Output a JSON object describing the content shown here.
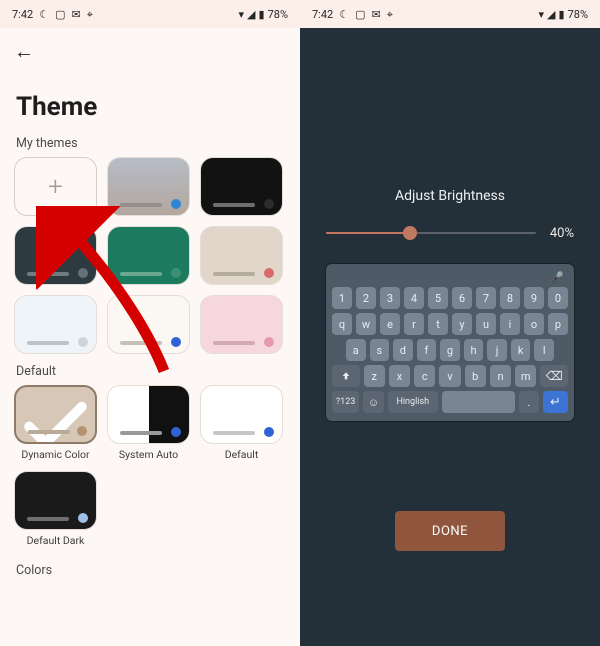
{
  "status": {
    "time": "7:42",
    "battery": "78%",
    "iconsLeft": [
      "moon",
      "card",
      "mail",
      "pin"
    ],
    "iconsRight": [
      "wifi",
      "signal",
      "battery"
    ]
  },
  "left": {
    "title": "Theme",
    "sections": {
      "myThemes": "My themes",
      "default": "Default",
      "colors": "Colors"
    },
    "myThemes": [
      {
        "type": "add"
      },
      {
        "type": "gradient",
        "dot": "#2f86d8"
      },
      {
        "type": "solid",
        "bg": "#121212",
        "bar": "#6e6e6e",
        "dot": "#2c2c2c"
      },
      {
        "type": "solid",
        "bg": "#2d3b40",
        "bar": "#6f7b80",
        "dot": "#647179"
      },
      {
        "type": "solid",
        "bg": "#1c7b5e",
        "bar": "#6aa892",
        "dot": "#3d8f74"
      },
      {
        "type": "solid",
        "bg": "#e1d6c9",
        "bar": "#b4ab9f",
        "dot": "#d86a6a"
      },
      {
        "type": "solid",
        "bg": "#eef4f7",
        "bar": "#bac4ca",
        "dot": "#cdd5da"
      },
      {
        "type": "solid",
        "bg": "#fbf7f3",
        "bar": "#c7c0b8",
        "dot": "#2f62d4"
      },
      {
        "type": "solid",
        "bg": "#f6d6df",
        "bar": "#d4a9b6",
        "dot": "#e59ab2"
      }
    ],
    "defaults": [
      {
        "label": "Dynamic Color",
        "bg": "#d7c7b7",
        "bar": "#b9aa99",
        "dot": "#b7926e",
        "selected": true
      },
      {
        "label": "System Auto",
        "split": true,
        "dot": "#2f62d4"
      },
      {
        "label": "Default",
        "bg": "#ffffff",
        "bar": "#c7c7c7",
        "dot": "#2f62d4"
      },
      {
        "label": "Default Dark",
        "bg": "#1a1a1a",
        "bar": "#6e6e6e",
        "dot": "#9fbfe6"
      }
    ]
  },
  "right": {
    "title": "Adjust Brightness",
    "value": "40%",
    "percent": 40,
    "keyboard": {
      "row1": [
        "1",
        "2",
        "3",
        "4",
        "5",
        "6",
        "7",
        "8",
        "9",
        "0"
      ],
      "row2": [
        "q",
        "w",
        "e",
        "r",
        "t",
        "y",
        "u",
        "i",
        "o",
        "p"
      ],
      "row3": [
        "a",
        "s",
        "d",
        "f",
        "g",
        "h",
        "j",
        "k",
        "l"
      ],
      "row4Mid": [
        "z",
        "x",
        "c",
        "v",
        "b",
        "n",
        "m"
      ],
      "sym": "?123",
      "langKey": "Hinglish"
    },
    "done": "DONE"
  }
}
